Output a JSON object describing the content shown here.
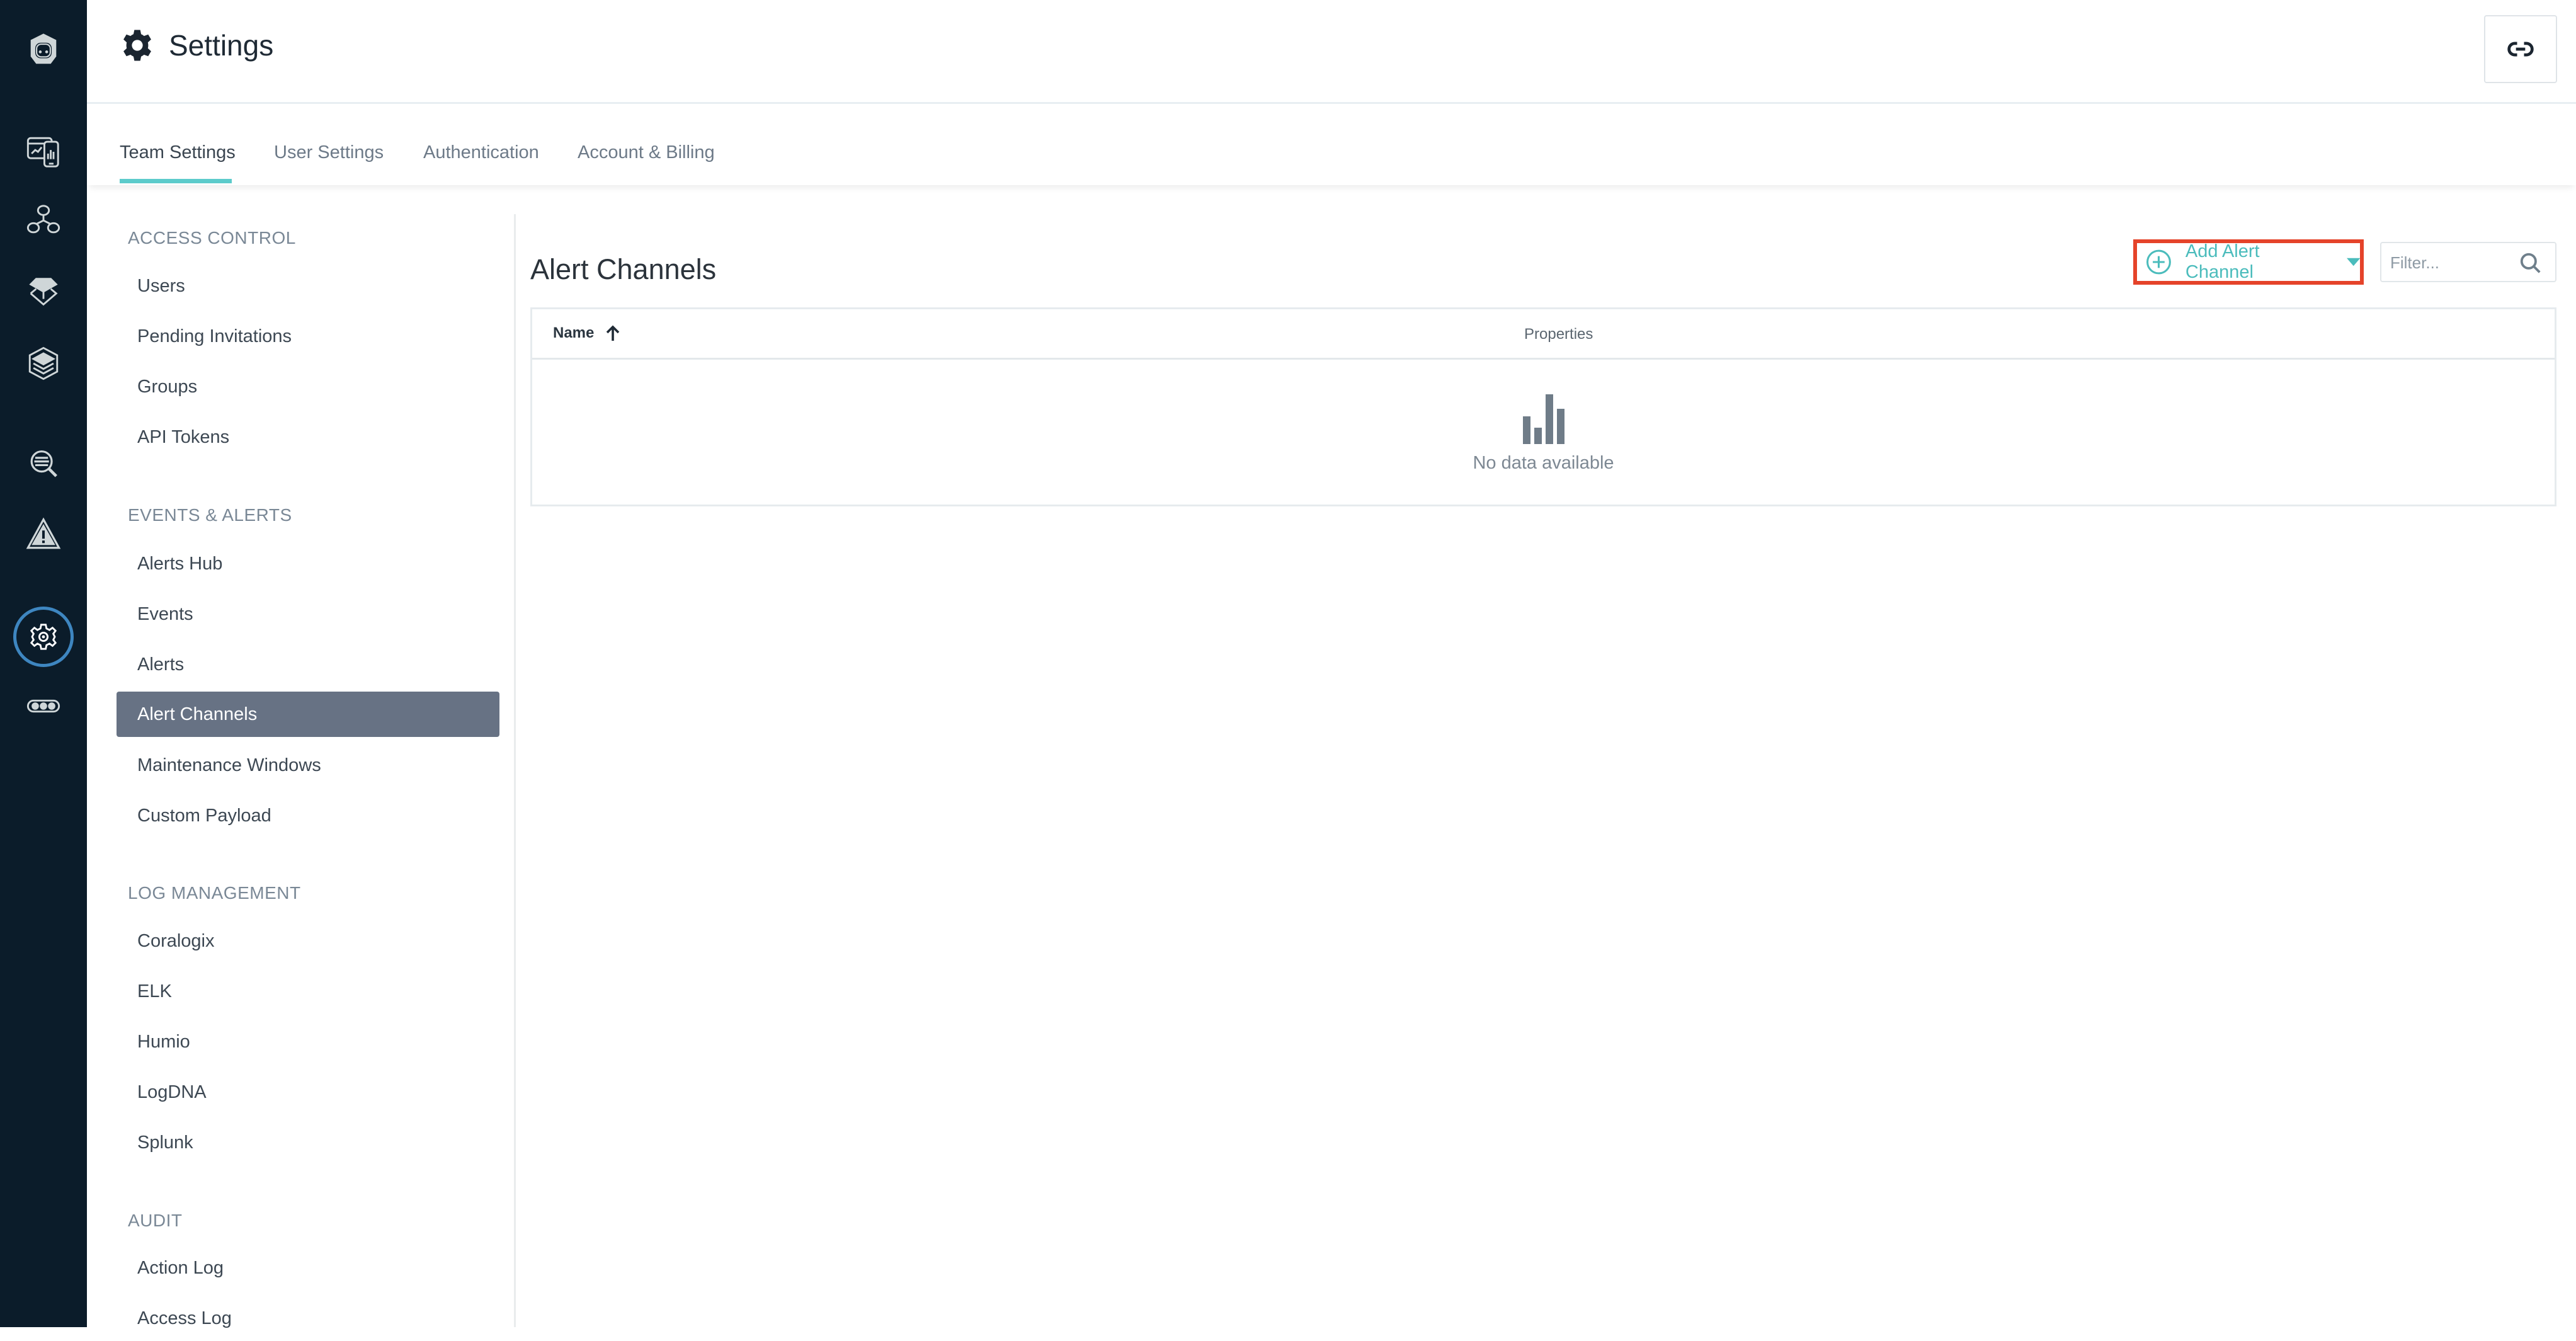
{
  "rail": {
    "items": [
      {
        "icon": "robot-logo-icon"
      },
      {
        "icon": "devices-dashboard-icon"
      },
      {
        "icon": "service-map-icon"
      },
      {
        "icon": "infrastructure-icon"
      },
      {
        "icon": "layers-stack-icon"
      },
      {
        "icon": "search-analytics-icon"
      },
      {
        "icon": "warning-triangle-icon"
      },
      {
        "icon": "gear-icon",
        "active": true
      },
      {
        "icon": "more-dots-icon"
      }
    ],
    "active_ring_color": "#3e86c0",
    "background": "#0b1c2a"
  },
  "header": {
    "title": "Settings",
    "icon": "gear-icon",
    "link_button_icon": "link-icon"
  },
  "tabs": [
    {
      "label": "Team Settings",
      "active": true
    },
    {
      "label": "User Settings",
      "active": false
    },
    {
      "label": "Authentication",
      "active": false
    },
    {
      "label": "Account & Billing",
      "active": false
    }
  ],
  "tab_accent": "#5ccbcb",
  "sidebar": {
    "sections": [
      {
        "heading": "ACCESS CONTROL",
        "items": [
          "Users",
          "Pending Invitations",
          "Groups",
          "API Tokens"
        ]
      },
      {
        "heading": "EVENTS & ALERTS",
        "items": [
          "Alerts Hub",
          "Events",
          "Alerts",
          "Alert Channels",
          "Maintenance Windows",
          "Custom Payload"
        ]
      },
      {
        "heading": "LOG MANAGEMENT",
        "items": [
          "Coralogix",
          "ELK",
          "Humio",
          "LogDNA",
          "Splunk"
        ]
      },
      {
        "heading": "AUDIT",
        "items": [
          "Action Log",
          "Access Log"
        ]
      }
    ],
    "selected": "Alert Channels",
    "selected_bg": "#677284"
  },
  "main": {
    "title": "Alert Channels",
    "add_button_label": "Add Alert Channel",
    "add_button_color": "#4bbcbc",
    "highlight_color": "#e5432a",
    "filter_placeholder": "Filter...",
    "filter_value": "",
    "table": {
      "columns": [
        {
          "label": "Name",
          "sort": "ascending"
        },
        {
          "label": "Properties"
        }
      ],
      "rows": [],
      "empty_message": "No data available"
    }
  }
}
